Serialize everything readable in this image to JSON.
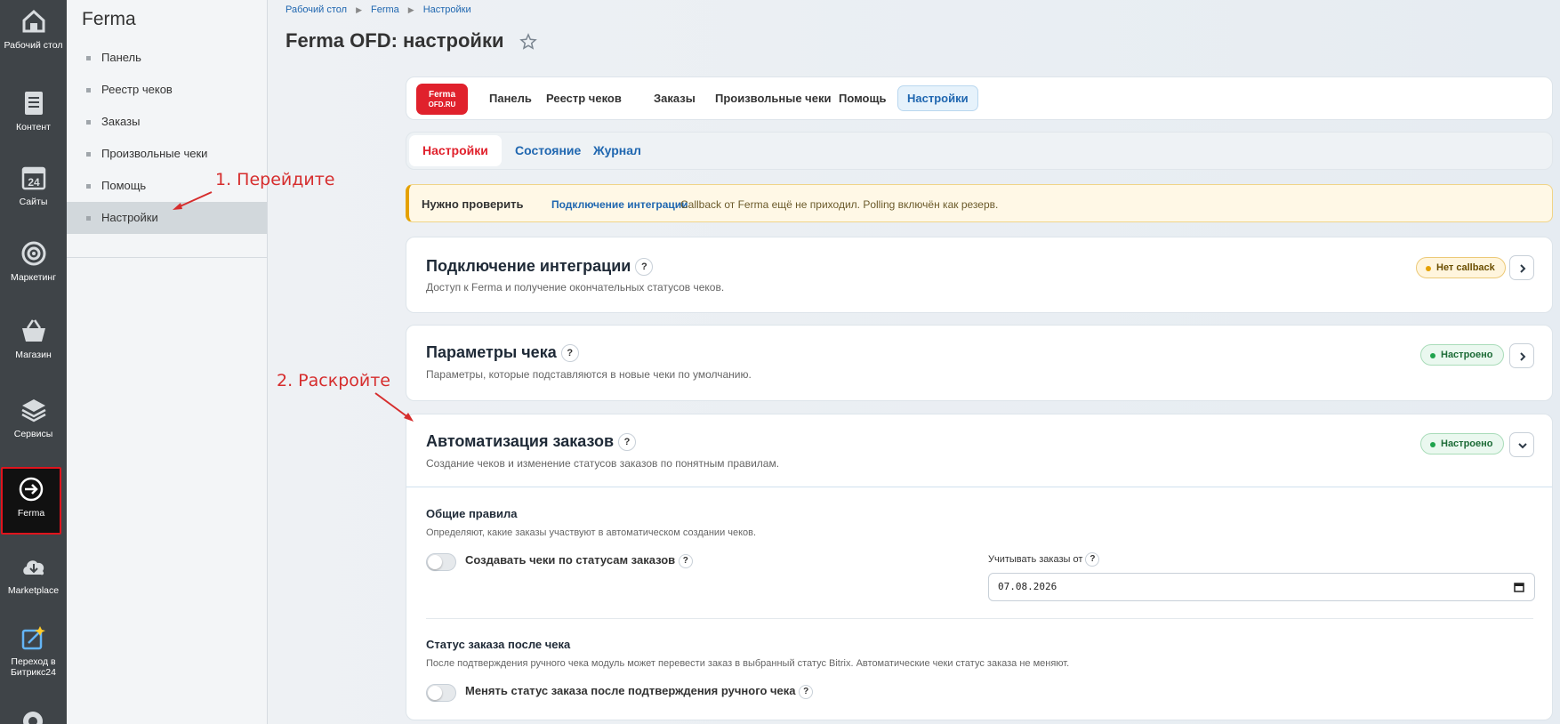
{
  "rail": {
    "items": [
      {
        "label": "Рабочий стол",
        "icon": "home-icon"
      },
      {
        "label": "Контент",
        "icon": "document-icon"
      },
      {
        "label": "Сайты",
        "icon": "calendar-24-icon"
      },
      {
        "label": "Маркетинг",
        "icon": "target-icon"
      },
      {
        "label": "Магазин",
        "icon": "basket-icon"
      },
      {
        "label": "Сервисы",
        "icon": "layers-icon"
      },
      {
        "label": "Ferma",
        "icon": "arrow-circle-icon"
      },
      {
        "label": "Marketplace",
        "icon": "cloud-download-icon"
      },
      {
        "label": "Переход в Битрикс24",
        "icon": "magic-icon"
      }
    ]
  },
  "submenu": {
    "title": "Ferma",
    "items": [
      "Панель",
      "Реестр чеков",
      "Заказы",
      "Произвольные чеки",
      "Помощь",
      "Настройки"
    ]
  },
  "breadcrumbs": [
    "Рабочий стол",
    "Ferma",
    "Настройки"
  ],
  "page": {
    "title": "Ferma OFD: настройки"
  },
  "topnav": {
    "logo_line1": "Ferma",
    "logo_line2": "OFD.RU",
    "items": [
      "Панель",
      "Реестр чеков",
      "Заказы",
      "Произвольные чеки",
      "Помощь",
      "Настройки"
    ]
  },
  "tabs": [
    "Настройки",
    "Состояние",
    "Журнал"
  ],
  "alert": {
    "label": "Нужно проверить",
    "link": "Подключение интеграции",
    "text": "Callback от Ferma ещё не приходил. Polling включён как резерв."
  },
  "sections": [
    {
      "title": "Подключение интеграции",
      "desc": "Доступ к Ferma и получение окончательных статусов чеков.",
      "badge": "Нет callback"
    },
    {
      "title": "Параметры чека",
      "desc": "Параметры, которые подставляются в новые чеки по умолчанию.",
      "badge": "Настроено"
    },
    {
      "title": "Автоматизация заказов",
      "desc": "Создание чеков и изменение статусов заказов по понятным правилам.",
      "badge": "Настроено"
    }
  ],
  "automation": {
    "general_title": "Общие правила",
    "general_desc": "Определяют, какие заказы участвуют в автоматическом создании чеков.",
    "toggle1_label": "Создавать чеки по статусам заказов",
    "date_label": "Учитывать заказы от",
    "date_value": "07.08.2026",
    "status_title": "Статус заказа после чека",
    "status_desc": "После подтверждения ручного чека модуль может перевести заказ в выбранный статус Bitrix. Автоматические чеки статус заказа не меняют.",
    "toggle2_label": "Менять статус заказа после подтверждения ручного чека"
  },
  "annotations": {
    "step1": "1. Перейдите",
    "step2": "2. Раскройте"
  },
  "colors": {
    "accent": "#2067b0",
    "brand_red": "#e0212c",
    "annotation": "#d62d2d"
  }
}
